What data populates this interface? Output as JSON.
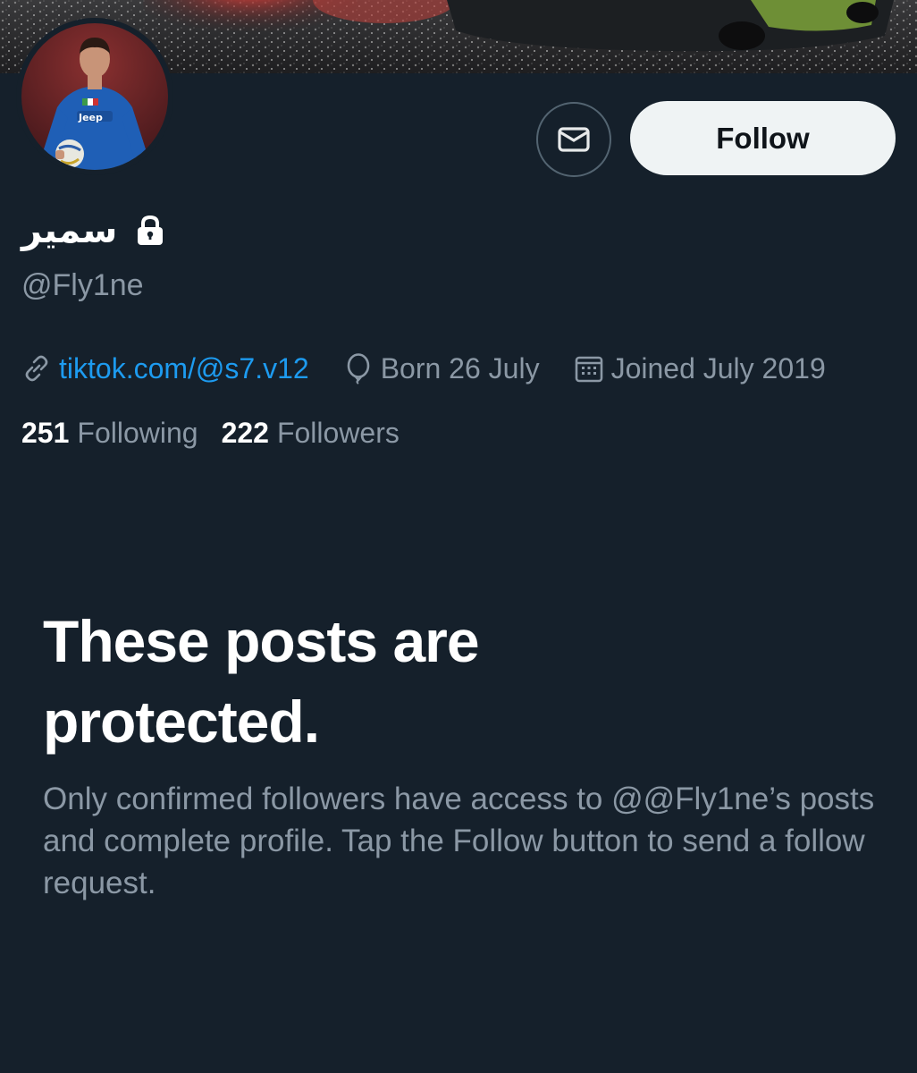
{
  "profile": {
    "display_name": "سمير",
    "handle": "@Fly1ne",
    "website": "tiktok.com/@s7.v12",
    "birthday": "Born 26 July",
    "joined": "Joined July 2019",
    "following_count": "251",
    "following_label": "Following",
    "followers_count": "222",
    "followers_label": "Followers"
  },
  "actions": {
    "follow_label": "Follow"
  },
  "protected_notice": {
    "title": "These posts are protected.",
    "body": "Only confirmed followers have access to @@Fly1ne’s posts and complete profile. Tap the Follow button to send a follow request."
  },
  "icons": {
    "lock": "lock-icon",
    "message": "envelope-icon",
    "website": "link-icon",
    "birthday": "balloon-icon",
    "joined": "calendar-icon"
  },
  "colors": {
    "background": "#15202b",
    "link": "#1d9bf0",
    "secondary_text": "#8b98a5",
    "follow_button_bg": "#eff3f4"
  }
}
